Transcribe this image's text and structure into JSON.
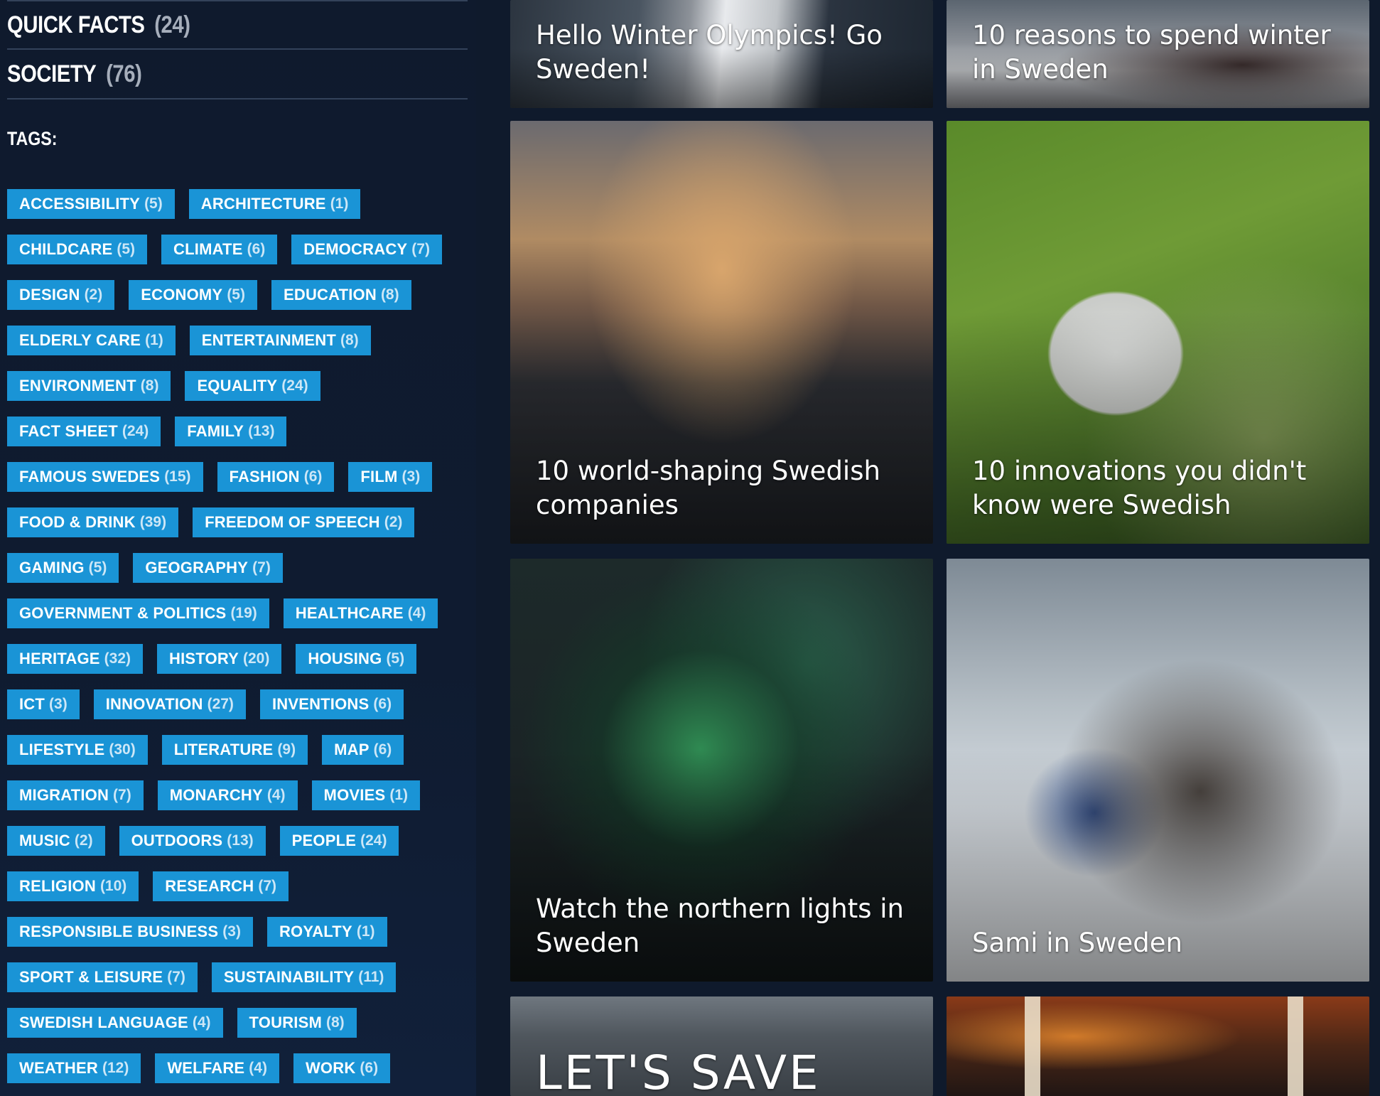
{
  "categories": [
    {
      "name": "QUICK FACTS",
      "count": "(24)"
    },
    {
      "name": "SOCIETY",
      "count": "(76)"
    }
  ],
  "tags_heading": "TAGS:",
  "tags": [
    {
      "label": "ACCESSIBILITY",
      "count": "(5)"
    },
    {
      "label": "ARCHITECTURE",
      "count": "(1)"
    },
    {
      "label": "CHILDCARE",
      "count": "(5)"
    },
    {
      "label": "CLIMATE",
      "count": "(6)"
    },
    {
      "label": "DEMOCRACY",
      "count": "(7)"
    },
    {
      "label": "DESIGN",
      "count": "(2)"
    },
    {
      "label": "ECONOMY",
      "count": "(5)"
    },
    {
      "label": "EDUCATION",
      "count": "(8)"
    },
    {
      "label": "ELDERLY CARE",
      "count": "(1)"
    },
    {
      "label": "ENTERTAINMENT",
      "count": "(8)"
    },
    {
      "label": "ENVIRONMENT",
      "count": "(8)"
    },
    {
      "label": "EQUALITY",
      "count": "(24)"
    },
    {
      "label": "FACT SHEET",
      "count": "(24)"
    },
    {
      "label": "FAMILY",
      "count": "(13)"
    },
    {
      "label": "FAMOUS SWEDES",
      "count": "(15)"
    },
    {
      "label": "FASHION",
      "count": "(6)"
    },
    {
      "label": "FILM",
      "count": "(3)"
    },
    {
      "label": "FOOD & DRINK",
      "count": "(39)"
    },
    {
      "label": "FREEDOM OF SPEECH",
      "count": "(2)"
    },
    {
      "label": "GAMING",
      "count": "(5)"
    },
    {
      "label": "GEOGRAPHY",
      "count": "(7)"
    },
    {
      "label": "GOVERNMENT & POLITICS",
      "count": "(19)"
    },
    {
      "label": "HEALTHCARE",
      "count": "(4)"
    },
    {
      "label": "HERITAGE",
      "count": "(32)"
    },
    {
      "label": "HISTORY",
      "count": "(20)"
    },
    {
      "label": "HOUSING",
      "count": "(5)"
    },
    {
      "label": "ICT",
      "count": "(3)"
    },
    {
      "label": "INNOVATION",
      "count": "(27)"
    },
    {
      "label": "INVENTIONS",
      "count": "(6)"
    },
    {
      "label": "LIFESTYLE",
      "count": "(30)"
    },
    {
      "label": "LITERATURE",
      "count": "(9)"
    },
    {
      "label": "MAP",
      "count": "(6)"
    },
    {
      "label": "MIGRATION",
      "count": "(7)"
    },
    {
      "label": "MONARCHY",
      "count": "(4)"
    },
    {
      "label": "MOVIES",
      "count": "(1)"
    },
    {
      "label": "MUSIC",
      "count": "(2)"
    },
    {
      "label": "OUTDOORS",
      "count": "(13)"
    },
    {
      "label": "PEOPLE",
      "count": "(24)"
    },
    {
      "label": "RELIGION",
      "count": "(10)"
    },
    {
      "label": "RESEARCH",
      "count": "(7)"
    },
    {
      "label": "RESPONSIBLE BUSINESS",
      "count": "(3)"
    },
    {
      "label": "ROYALTY",
      "count": "(1)"
    },
    {
      "label": "SPORT & LEISURE",
      "count": "(7)"
    },
    {
      "label": "SUSTAINABILITY",
      "count": "(11)"
    },
    {
      "label": "SWEDISH LANGUAGE",
      "count": "(4)"
    },
    {
      "label": "TOURISM",
      "count": "(8)"
    },
    {
      "label": "WEATHER",
      "count": "(12)"
    },
    {
      "label": "WELFARE",
      "count": "(4)"
    },
    {
      "label": "WORK",
      "count": "(6)"
    }
  ],
  "cards": [
    {
      "title": "Hello Winter Olympics! Go Sweden!"
    },
    {
      "title": "10 reasons to spend winter in Sweden"
    },
    {
      "title": "10 world-shaping Swedish companies"
    },
    {
      "title": "10 innovations you didn't know were Swedish"
    },
    {
      "title": "Watch the northern lights in Sweden"
    },
    {
      "title": "Sami in Sweden"
    },
    {
      "title": "LET'S SAVE THE"
    },
    {
      "title": ""
    }
  ],
  "colors": {
    "background": "#0f1a2c",
    "tag_background": "#1a94d6",
    "divider": "#33425a"
  }
}
